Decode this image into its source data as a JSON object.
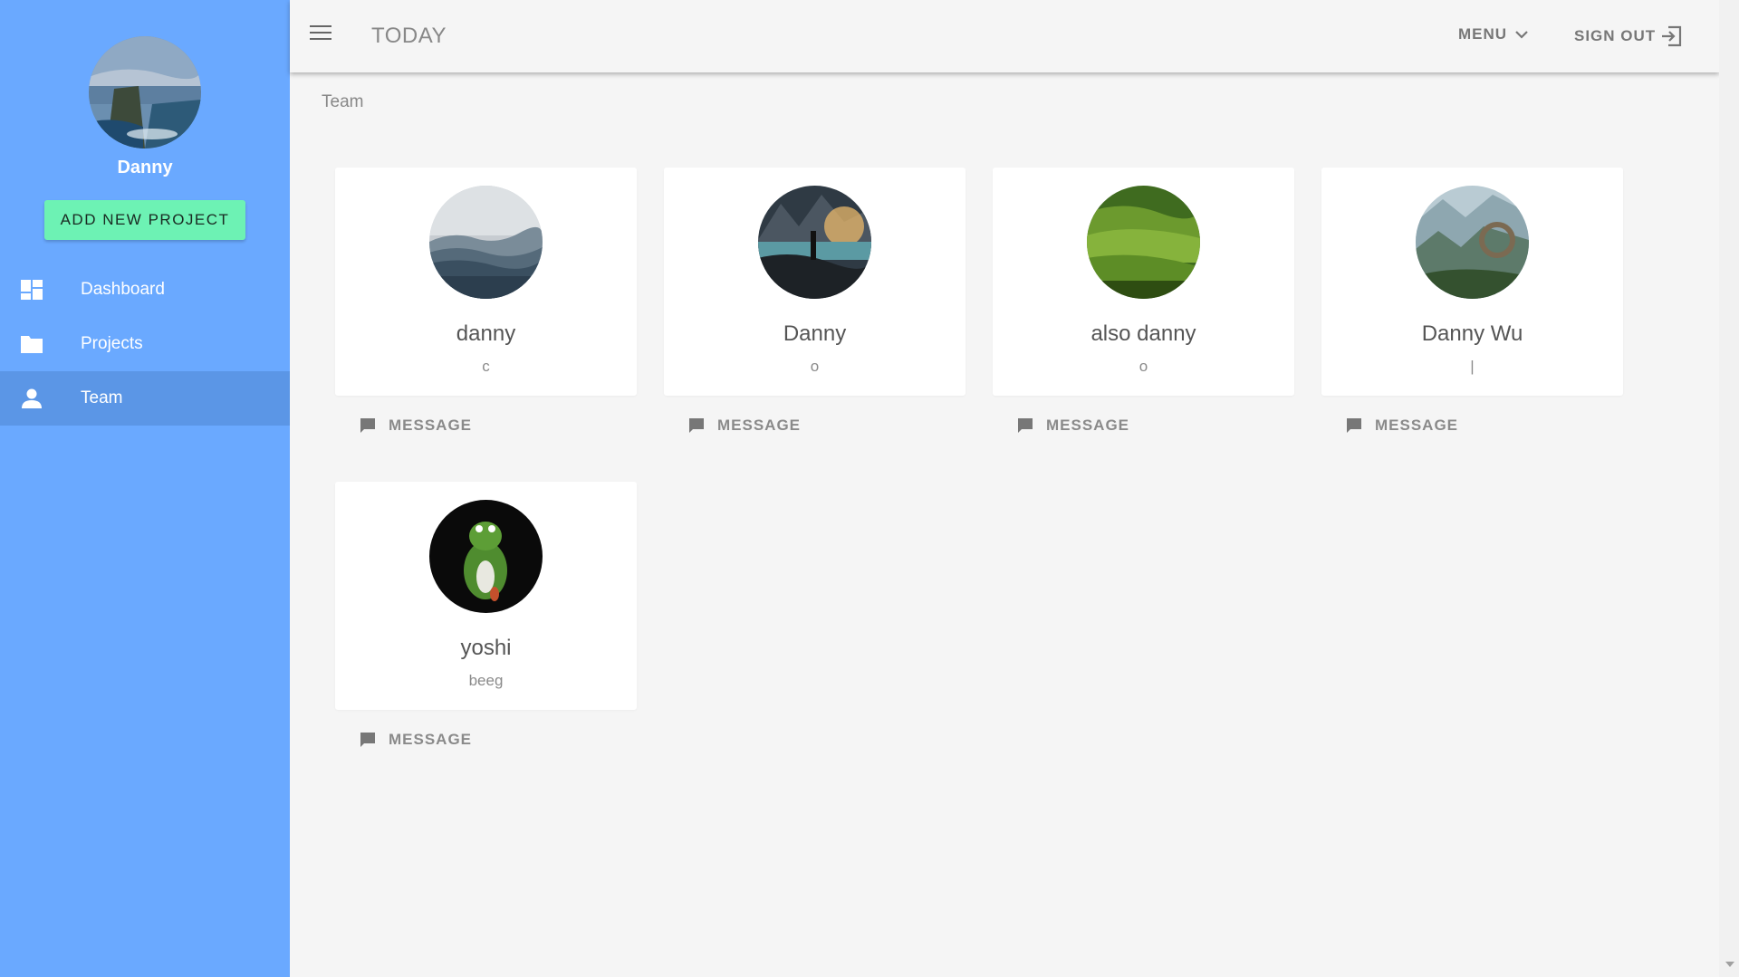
{
  "sidebar": {
    "user_name": "Danny",
    "add_project_label": "ADD NEW PROJECT",
    "items": [
      {
        "label": "Dashboard",
        "icon": "dashboard-icon"
      },
      {
        "label": "Projects",
        "icon": "folder-icon"
      },
      {
        "label": "Team",
        "icon": "person-icon",
        "active": true
      }
    ]
  },
  "topbar": {
    "title": "TODAY",
    "menu_label": "MENU",
    "signout_label": "SIGN OUT"
  },
  "main": {
    "breadcrumb": "Team",
    "message_label": "MESSAGE",
    "members": [
      {
        "name": "danny",
        "role": "c"
      },
      {
        "name": "Danny",
        "role": "o"
      },
      {
        "name": "also danny",
        "role": "o"
      },
      {
        "name": "Danny Wu",
        "role": "|"
      },
      {
        "name": "yoshi",
        "role": "beeg"
      }
    ]
  },
  "colors": {
    "sidebar": "#6aa9ff",
    "sidebar_active": "#5b96e6",
    "accent_button": "#6df2b4",
    "background": "#f5f5f5"
  }
}
